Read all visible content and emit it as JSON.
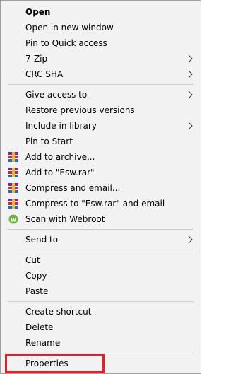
{
  "context_menu": {
    "items": {
      "open": {
        "label": "Open"
      },
      "open_new_window": {
        "label": "Open in new window"
      },
      "pin_quick_access": {
        "label": "Pin to Quick access"
      },
      "seven_zip": {
        "label": "7-Zip",
        "submenu_icon": "chevron-right-icon"
      },
      "crc_sha": {
        "label": "CRC SHA",
        "submenu_icon": "chevron-right-icon"
      },
      "give_access": {
        "label": "Give access to",
        "submenu_icon": "chevron-right-icon"
      },
      "restore_previous": {
        "label": "Restore previous versions"
      },
      "include_library": {
        "label": "Include in library",
        "submenu_icon": "chevron-right-icon"
      },
      "pin_start": {
        "label": "Pin to Start"
      },
      "add_archive": {
        "label": "Add to archive...",
        "icon": "winrar-icon"
      },
      "add_esw_rar": {
        "label": "Add to \"Esw.rar\"",
        "icon": "winrar-icon"
      },
      "compress_email": {
        "label": "Compress and email...",
        "icon": "winrar-icon"
      },
      "compress_esw_email": {
        "label": "Compress to \"Esw.rar\" and email",
        "icon": "winrar-icon"
      },
      "scan_webroot": {
        "label": "Scan with Webroot",
        "icon": "webroot-icon"
      },
      "send_to": {
        "label": "Send to",
        "submenu_icon": "chevron-right-icon"
      },
      "cut": {
        "label": "Cut"
      },
      "copy": {
        "label": "Copy"
      },
      "paste": {
        "label": "Paste"
      },
      "create_shortcut": {
        "label": "Create shortcut"
      },
      "delete": {
        "label": "Delete"
      },
      "rename": {
        "label": "Rename"
      },
      "properties": {
        "label": "Properties"
      }
    }
  },
  "colors": {
    "menu_background": "#f2f2f2",
    "separator": "#cfcfcf",
    "highlight_border": "#e0212a",
    "webroot_green": "#6cb33f"
  }
}
